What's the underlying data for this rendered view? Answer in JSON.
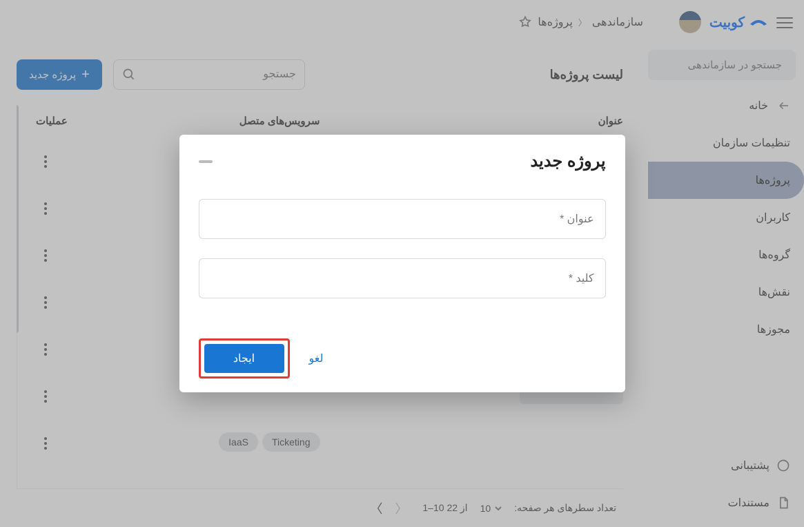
{
  "header": {
    "brand": "کوبیت",
    "breadcrumb_root": "سازماندهی",
    "breadcrumb_current": "پروژه‌ها"
  },
  "sidebar": {
    "search_placeholder": "جستجو در سازماندهی",
    "home": "خانه",
    "items": [
      {
        "label": "تنظیمات سازمان"
      },
      {
        "label": "پروژه‌ها"
      },
      {
        "label": "کاربران"
      },
      {
        "label": "گروه‌ها"
      },
      {
        "label": "نقش‌ها"
      },
      {
        "label": "مجوزها"
      }
    ],
    "support": "پشتیبانی",
    "docs": "مستندات"
  },
  "main": {
    "list_title": "لیست پروژه‌ها",
    "search_placeholder": "جستجو",
    "new_project_btn": "پروژه جدید",
    "columns": {
      "title": "عنوان",
      "services": "سرویس‌های متصل",
      "ops": "عملیات"
    },
    "rows": [
      {
        "services": []
      },
      {
        "services": []
      },
      {
        "services": []
      },
      {
        "services": []
      },
      {
        "services": []
      },
      {
        "services": []
      },
      {
        "services": [
          "Ticketing",
          "IaaS"
        ]
      }
    ]
  },
  "pagination": {
    "rows_label": "تعداد سطرهای هر صفحه:",
    "page_size": "10",
    "range": "1–10 از 22"
  },
  "dialog": {
    "title": "پروژه جدید",
    "title_field": "عنوان *",
    "key_field": "کلید *",
    "cancel": "لغو",
    "create": "ایجاد"
  }
}
